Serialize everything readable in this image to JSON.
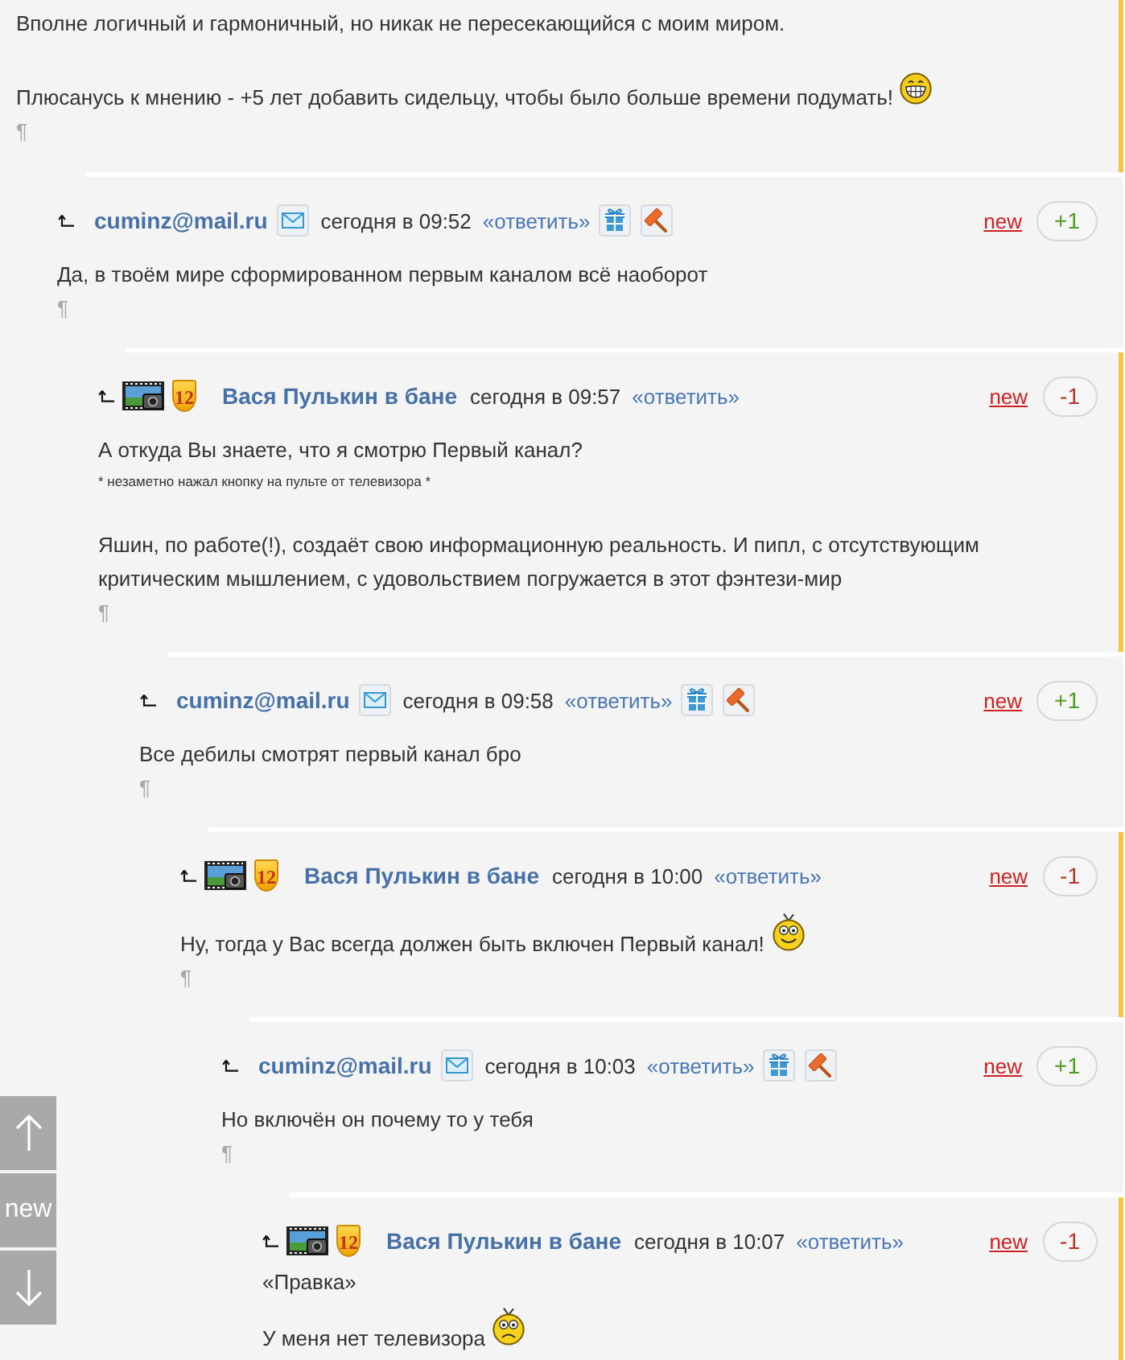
{
  "thread": {
    "highlighted": true,
    "paragraphs": [
      {
        "kind": "text",
        "text": "Вполне логичный и гармоничный, но никак не пересекающийся с моим миром."
      },
      {
        "kind": "text",
        "text": "Плюсанусь к мнению - +5 лет добавить сидельцу, чтобы было больше времени подумать!",
        "emoticon": {
          "kind": "grin"
        }
      }
    ],
    "end_mark": "¶",
    "children": [
      {
        "kind": "email",
        "author": "cuminz@mail.ru",
        "time": "сегодня в 09:52",
        "reply": "«ответить»",
        "new": "new",
        "rating": {
          "text": "+1",
          "kind": "positive"
        },
        "highlighted": false,
        "paragraphs": [
          {
            "kind": "text",
            "text": "Да, в твоём мире сформированном первым каналом всё наоборот"
          }
        ],
        "end_mark": "¶",
        "children": [
          {
            "kind": "member",
            "badge": "12",
            "author": "Вася Пулькин в бане",
            "time": "сегодня в 09:57",
            "reply": "«ответить»",
            "new": "new",
            "rating": {
              "text": "-1",
              "kind": "negative"
            },
            "highlighted": true,
            "paragraphs": [
              {
                "kind": "text",
                "text": "А откуда Вы знаете, что я смотрю Первый канал?"
              },
              {
                "kind": "note",
                "text": "* незаметно нажал кнопку на пульте от телевизора *"
              },
              {
                "kind": "text",
                "text": "Яшин, по работе(!), создаёт свою информационную реальность. И пипл, с отсутствующим критическим мышлением, с удовольствием погружается в этот фэнтези-мир"
              }
            ],
            "end_mark": "¶",
            "children": [
              {
                "kind": "email",
                "author": "cuminz@mail.ru",
                "time": "сегодня в 09:58",
                "reply": "«ответить»",
                "new": "new",
                "rating": {
                  "text": "+1",
                  "kind": "positive"
                },
                "highlighted": false,
                "paragraphs": [
                  {
                    "kind": "text",
                    "text": "Все дебилы смотрят первый канал бро"
                  }
                ],
                "end_mark": "¶",
                "children": [
                  {
                    "kind": "member",
                    "badge": "12",
                    "author": "Вася Пулькин в бане",
                    "time": "сегодня в 10:00",
                    "reply": "«ответить»",
                    "new": "new",
                    "rating": {
                      "text": "-1",
                      "kind": "negative"
                    },
                    "highlighted": true,
                    "paragraphs": [
                      {
                        "kind": "text",
                        "text": "Ну, тогда у Вас всегда должен быть включен Первый канал!",
                        "emoticon": {
                          "kind": "happy"
                        }
                      }
                    ],
                    "end_mark": "¶",
                    "children": [
                      {
                        "kind": "email",
                        "author": "cuminz@mail.ru",
                        "time": "сегодня в 10:03",
                        "reply": "«ответить»",
                        "new": "new",
                        "rating": {
                          "text": "+1",
                          "kind": "positive"
                        },
                        "highlighted": false,
                        "paragraphs": [
                          {
                            "kind": "text",
                            "text": "Но включён он почему то у тебя"
                          }
                        ],
                        "end_mark": "¶",
                        "children": [
                          {
                            "kind": "member",
                            "badge": "12",
                            "author": "Вася Пулькин в бане",
                            "time": "сегодня в 10:07",
                            "reply": "«ответить»",
                            "new": "new",
                            "rating": {
                              "text": "-1",
                              "kind": "negative"
                            },
                            "highlighted": true,
                            "paragraphs": [
                              {
                                "kind": "edit",
                                "text": "«Правка»"
                              },
                              {
                                "kind": "text",
                                "text": "У меня нет телевизора",
                                "emoticon": {
                                  "kind": "sad"
                                }
                              }
                            ]
                          }
                        ]
                      }
                    ]
                  }
                ]
              }
            ]
          }
        ]
      }
    ]
  },
  "scroll_nav": {
    "new_label": "new"
  }
}
